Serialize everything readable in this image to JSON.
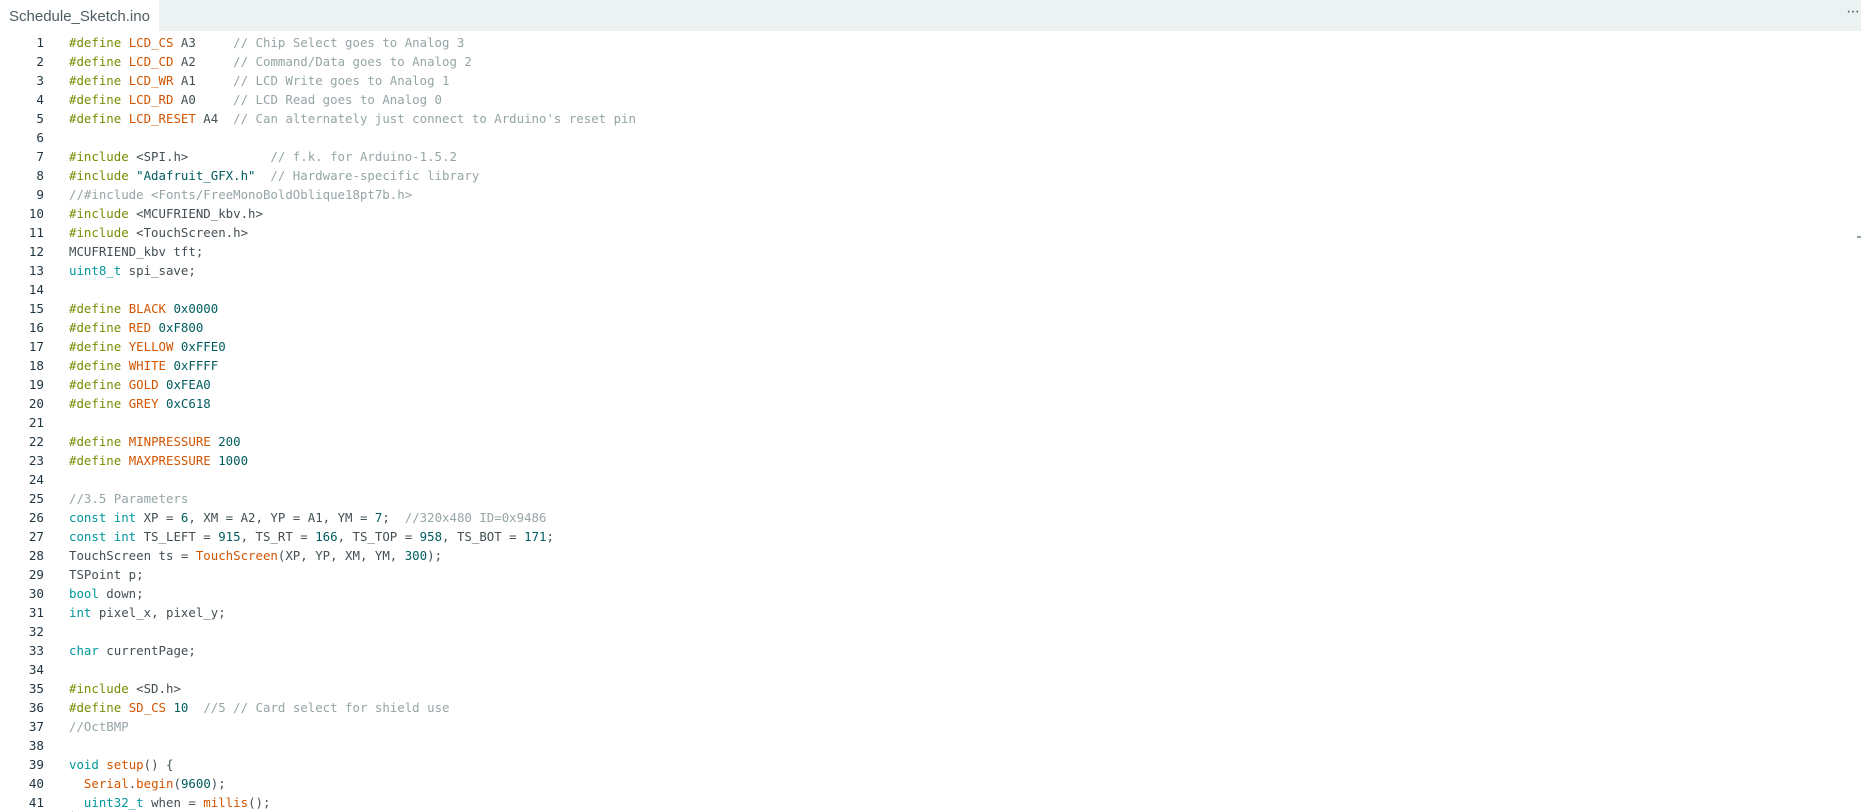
{
  "tab": {
    "title": "Schedule_Sketch.ino"
  },
  "menu": {
    "more_label": "···"
  },
  "theme": {
    "macro": "#728e00",
    "name": "#d35400",
    "type": "#00979c",
    "string": "#005c5f",
    "comment": "#95a5a6",
    "text": "#434f54"
  },
  "lines": [
    {
      "n": "1",
      "tokens": [
        [
          "m",
          "#define "
        ],
        [
          "n",
          "LCD_CS"
        ],
        [
          "p",
          " A3     "
        ],
        [
          "c",
          "// Chip Select goes to Analog 3"
        ]
      ]
    },
    {
      "n": "2",
      "tokens": [
        [
          "m",
          "#define "
        ],
        [
          "n",
          "LCD_CD"
        ],
        [
          "p",
          " A2     "
        ],
        [
          "c",
          "// Command/Data goes to Analog 2"
        ]
      ]
    },
    {
      "n": "3",
      "tokens": [
        [
          "m",
          "#define "
        ],
        [
          "n",
          "LCD_WR"
        ],
        [
          "p",
          " A1     "
        ],
        [
          "c",
          "// LCD Write goes to Analog 1"
        ]
      ]
    },
    {
      "n": "4",
      "tokens": [
        [
          "m",
          "#define "
        ],
        [
          "n",
          "LCD_RD"
        ],
        [
          "p",
          " A0     "
        ],
        [
          "c",
          "// LCD Read goes to Analog 0"
        ]
      ]
    },
    {
      "n": "5",
      "tokens": [
        [
          "m",
          "#define "
        ],
        [
          "n",
          "LCD_RESET"
        ],
        [
          "p",
          " A4  "
        ],
        [
          "c",
          "// Can alternately just connect to Arduino's reset pin"
        ]
      ]
    },
    {
      "n": "6",
      "tokens": []
    },
    {
      "n": "7",
      "tokens": [
        [
          "m",
          "#include "
        ],
        [
          "p",
          "<SPI.h>           "
        ],
        [
          "c",
          "// f.k. for Arduino-1.5.2"
        ]
      ]
    },
    {
      "n": "8",
      "tokens": [
        [
          "m",
          "#include "
        ],
        [
          "s",
          "\"Adafruit_GFX.h\""
        ],
        [
          "p",
          "  "
        ],
        [
          "c",
          "// Hardware-specific library"
        ]
      ]
    },
    {
      "n": "9",
      "tokens": [
        [
          "c",
          "//#include <Fonts/FreeMonoBoldOblique18pt7b.h>"
        ]
      ]
    },
    {
      "n": "10",
      "tokens": [
        [
          "m",
          "#include "
        ],
        [
          "p",
          "<MCUFRIEND_kbv.h>"
        ]
      ]
    },
    {
      "n": "11",
      "tokens": [
        [
          "m",
          "#include "
        ],
        [
          "p",
          "<TouchScreen.h>"
        ]
      ]
    },
    {
      "n": "12",
      "tokens": [
        [
          "p",
          "MCUFRIEND_kbv tft;"
        ]
      ]
    },
    {
      "n": "13",
      "tokens": [
        [
          "t",
          "uint8_t"
        ],
        [
          "p",
          " spi_save;"
        ]
      ]
    },
    {
      "n": "14",
      "tokens": []
    },
    {
      "n": "15",
      "tokens": [
        [
          "m",
          "#define "
        ],
        [
          "n",
          "BLACK"
        ],
        [
          "p",
          " "
        ],
        [
          "s",
          "0x0000"
        ]
      ]
    },
    {
      "n": "16",
      "tokens": [
        [
          "m",
          "#define "
        ],
        [
          "n",
          "RED"
        ],
        [
          "p",
          " "
        ],
        [
          "s",
          "0xF800"
        ]
      ]
    },
    {
      "n": "17",
      "tokens": [
        [
          "m",
          "#define "
        ],
        [
          "n",
          "YELLOW"
        ],
        [
          "p",
          " "
        ],
        [
          "s",
          "0xFFE0"
        ]
      ]
    },
    {
      "n": "18",
      "tokens": [
        [
          "m",
          "#define "
        ],
        [
          "n",
          "WHITE"
        ],
        [
          "p",
          " "
        ],
        [
          "s",
          "0xFFFF"
        ]
      ]
    },
    {
      "n": "19",
      "tokens": [
        [
          "m",
          "#define "
        ],
        [
          "n",
          "GOLD"
        ],
        [
          "p",
          " "
        ],
        [
          "s",
          "0xFEA0"
        ]
      ]
    },
    {
      "n": "20",
      "tokens": [
        [
          "m",
          "#define "
        ],
        [
          "n",
          "GREY"
        ],
        [
          "p",
          " "
        ],
        [
          "s",
          "0xC618"
        ]
      ]
    },
    {
      "n": "21",
      "tokens": []
    },
    {
      "n": "22",
      "tokens": [
        [
          "m",
          "#define "
        ],
        [
          "n",
          "MINPRESSURE"
        ],
        [
          "p",
          " "
        ],
        [
          "s",
          "200"
        ]
      ]
    },
    {
      "n": "23",
      "tokens": [
        [
          "m",
          "#define "
        ],
        [
          "n",
          "MAXPRESSURE"
        ],
        [
          "p",
          " "
        ],
        [
          "s",
          "1000"
        ]
      ]
    },
    {
      "n": "24",
      "tokens": []
    },
    {
      "n": "25",
      "tokens": [
        [
          "c",
          "//3.5 Parameters"
        ]
      ]
    },
    {
      "n": "26",
      "tokens": [
        [
          "t",
          "const int"
        ],
        [
          "p",
          " XP = "
        ],
        [
          "s",
          "6"
        ],
        [
          "p",
          ", XM = A2, YP = A1, YM = "
        ],
        [
          "s",
          "7"
        ],
        [
          "p",
          ";  "
        ],
        [
          "c",
          "//320x480 ID=0x9486"
        ]
      ]
    },
    {
      "n": "27",
      "tokens": [
        [
          "t",
          "const int"
        ],
        [
          "p",
          " TS_LEFT = "
        ],
        [
          "s",
          "915"
        ],
        [
          "p",
          ", TS_RT = "
        ],
        [
          "s",
          "166"
        ],
        [
          "p",
          ", TS_TOP = "
        ],
        [
          "s",
          "958"
        ],
        [
          "p",
          ", TS_BOT = "
        ],
        [
          "s",
          "171"
        ],
        [
          "p",
          ";"
        ]
      ]
    },
    {
      "n": "28",
      "tokens": [
        [
          "p",
          "TouchScreen ts = "
        ],
        [
          "f",
          "TouchScreen"
        ],
        [
          "p",
          "(XP, YP, XM, YM, "
        ],
        [
          "s",
          "300"
        ],
        [
          "p",
          ");"
        ]
      ]
    },
    {
      "n": "29",
      "tokens": [
        [
          "p",
          "TSPoint p;"
        ]
      ]
    },
    {
      "n": "30",
      "tokens": [
        [
          "t",
          "bool"
        ],
        [
          "p",
          " down;"
        ]
      ]
    },
    {
      "n": "31",
      "tokens": [
        [
          "t",
          "int"
        ],
        [
          "p",
          " pixel_x, pixel_y;"
        ]
      ]
    },
    {
      "n": "32",
      "tokens": []
    },
    {
      "n": "33",
      "tokens": [
        [
          "t",
          "char"
        ],
        [
          "p",
          " currentPage;"
        ]
      ]
    },
    {
      "n": "34",
      "tokens": []
    },
    {
      "n": "35",
      "tokens": [
        [
          "m",
          "#include "
        ],
        [
          "p",
          "<SD.h>"
        ]
      ]
    },
    {
      "n": "36",
      "tokens": [
        [
          "m",
          "#define "
        ],
        [
          "n",
          "SD_CS"
        ],
        [
          "p",
          " "
        ],
        [
          "s",
          "10"
        ],
        [
          "p",
          "  "
        ],
        [
          "c",
          "//5 // Card select for shield use"
        ]
      ]
    },
    {
      "n": "37",
      "tokens": [
        [
          "c",
          "//OctBMP"
        ]
      ]
    },
    {
      "n": "38",
      "tokens": []
    },
    {
      "n": "39",
      "tokens": [
        [
          "t",
          "void"
        ],
        [
          "p",
          " "
        ],
        [
          "f",
          "setup"
        ],
        [
          "p",
          "() {"
        ]
      ]
    },
    {
      "n": "40",
      "tokens": [
        [
          "p",
          "  "
        ],
        [
          "f",
          "Serial"
        ],
        [
          "p",
          "."
        ],
        [
          "f",
          "begin"
        ],
        [
          "p",
          "("
        ],
        [
          "s",
          "9600"
        ],
        [
          "p",
          ");"
        ]
      ]
    },
    {
      "n": "41",
      "tokens": [
        [
          "p",
          "  "
        ],
        [
          "t",
          "uint32_t"
        ],
        [
          "p",
          " when = "
        ],
        [
          "f",
          "millis"
        ],
        [
          "p",
          "();"
        ]
      ]
    }
  ]
}
